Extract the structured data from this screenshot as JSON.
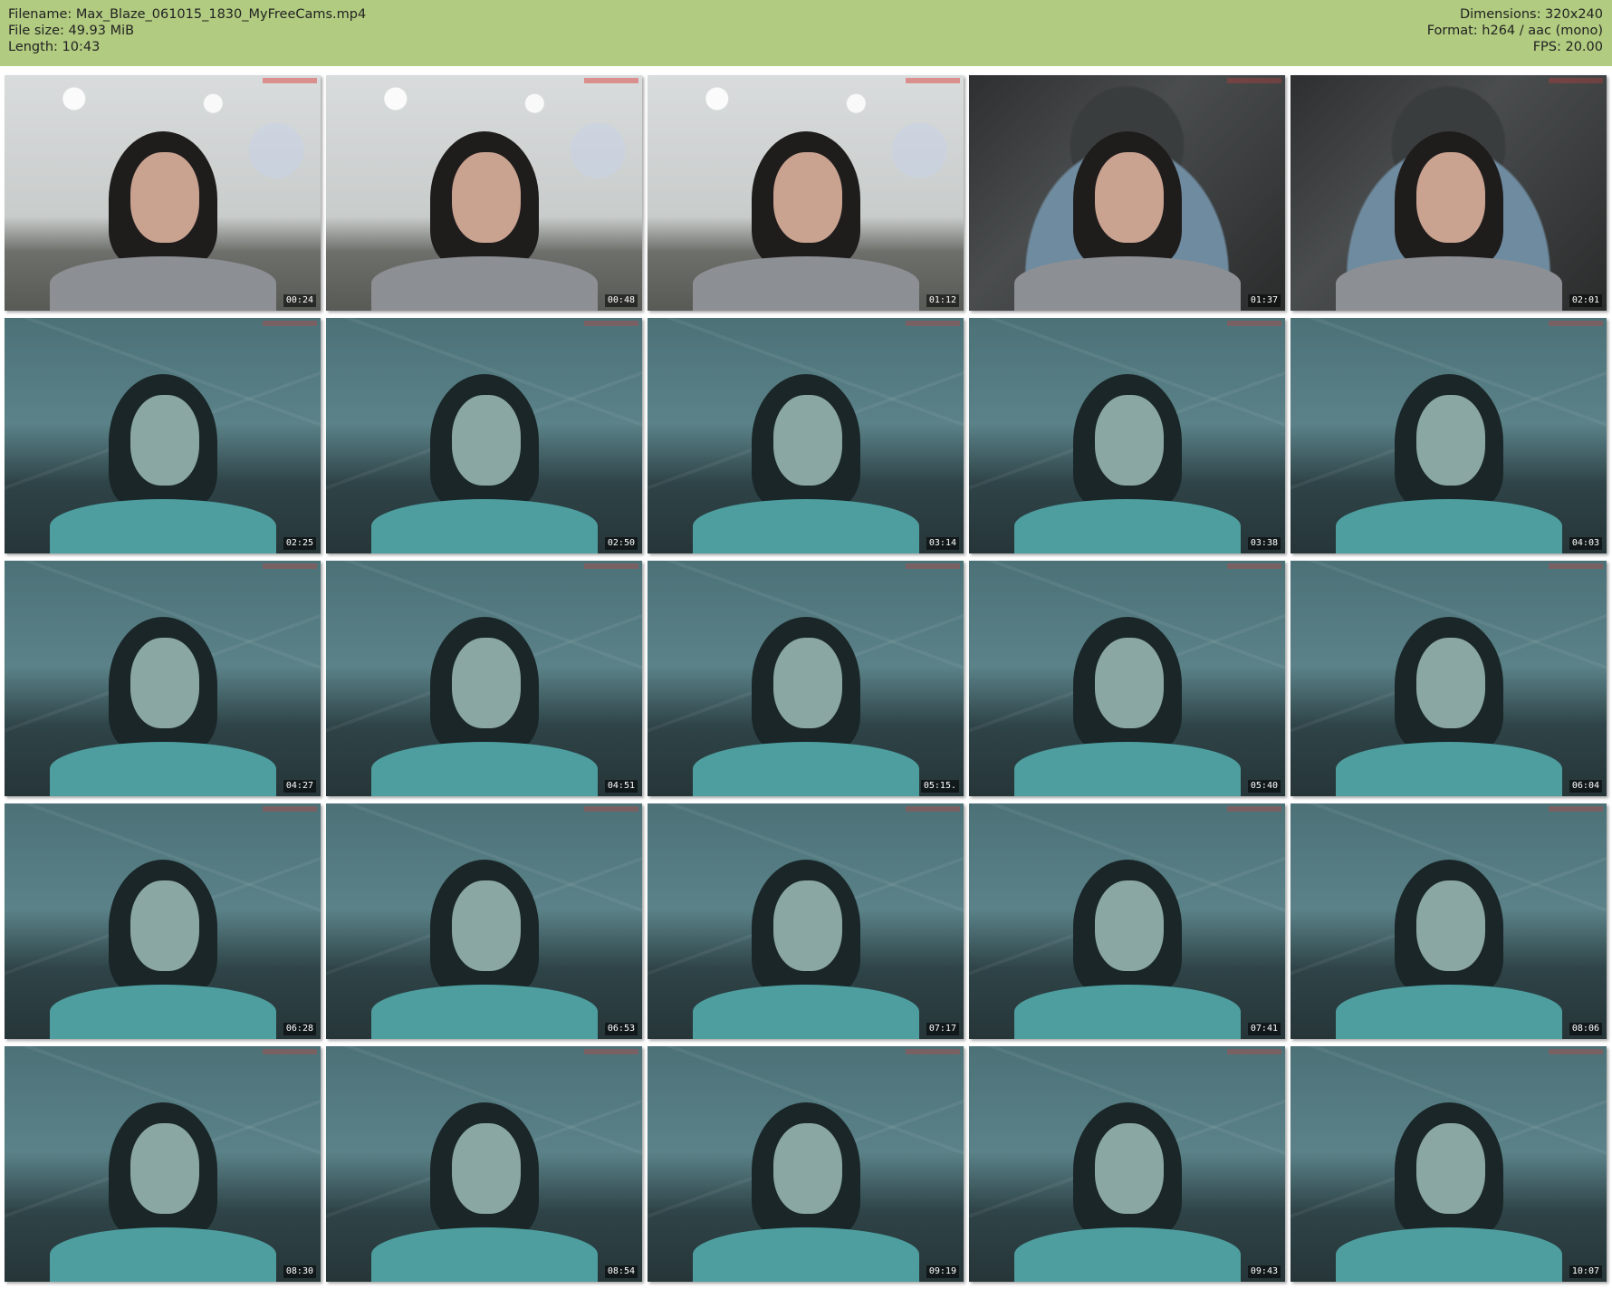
{
  "header": {
    "filename": "Filename: Max_Blaze_061015_1830_MyFreeCams.mp4",
    "filesize": "File size: 49.93 MiB",
    "length": "Length: 10:43",
    "dimensions": "Dimensions: 320x240",
    "format": "Format: h264 / aac (mono)",
    "fps": "FPS: 20.00"
  },
  "thumbnails": [
    {
      "time": "00:24",
      "scene": "office"
    },
    {
      "time": "00:48",
      "scene": "office"
    },
    {
      "time": "01:12",
      "scene": "office"
    },
    {
      "time": "01:37",
      "scene": "blur"
    },
    {
      "time": "02:01",
      "scene": "blur"
    },
    {
      "time": "02:25",
      "scene": "teal"
    },
    {
      "time": "02:50",
      "scene": "teal"
    },
    {
      "time": "03:14",
      "scene": "teal"
    },
    {
      "time": "03:38",
      "scene": "teal"
    },
    {
      "time": "04:03",
      "scene": "teal"
    },
    {
      "time": "04:27",
      "scene": "teal"
    },
    {
      "time": "04:51",
      "scene": "teal"
    },
    {
      "time": "05:15.",
      "scene": "teal"
    },
    {
      "time": "05:40",
      "scene": "teal"
    },
    {
      "time": "06:04",
      "scene": "teal"
    },
    {
      "time": "06:28",
      "scene": "teal"
    },
    {
      "time": "06:53",
      "scene": "teal"
    },
    {
      "time": "07:17",
      "scene": "teal"
    },
    {
      "time": "07:41",
      "scene": "teal"
    },
    {
      "time": "08:06",
      "scene": "teal"
    },
    {
      "time": "08:30",
      "scene": "teal"
    },
    {
      "time": "08:54",
      "scene": "teal"
    },
    {
      "time": "09:19",
      "scene": "teal"
    },
    {
      "time": "09:43",
      "scene": "teal"
    },
    {
      "time": "10:07",
      "scene": "teal"
    }
  ]
}
